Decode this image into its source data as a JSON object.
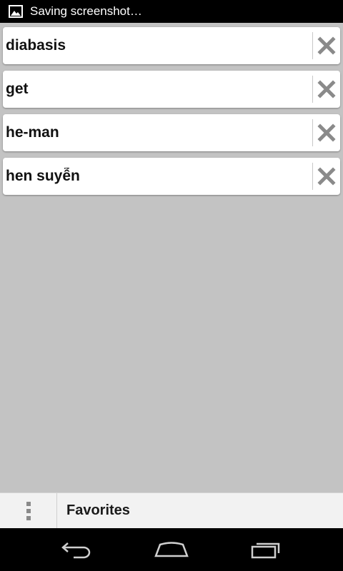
{
  "status_bar": {
    "notification_icon": "image-icon",
    "text": "Saving screenshot…"
  },
  "favorites": {
    "items": [
      {
        "word": "diabasis",
        "delete_icon": "close-icon"
      },
      {
        "word": "get",
        "delete_icon": "close-icon"
      },
      {
        "word": "he-man",
        "delete_icon": "close-icon"
      },
      {
        "word": "hen suyễn",
        "delete_icon": "close-icon"
      }
    ]
  },
  "bottom_bar": {
    "menu_icon": "overflow-menu-icon",
    "title": "Favorites"
  },
  "nav_bar": {
    "back_icon": "back-icon",
    "home_icon": "home-icon",
    "recents_icon": "recent-apps-icon"
  },
  "colors": {
    "background": "#c3c3c3",
    "card": "#ffffff",
    "delete_icon": "#8a8a8a",
    "status_bar": "#000000",
    "nav_bar": "#000000",
    "bottom_bar": "#f2f2f2"
  }
}
